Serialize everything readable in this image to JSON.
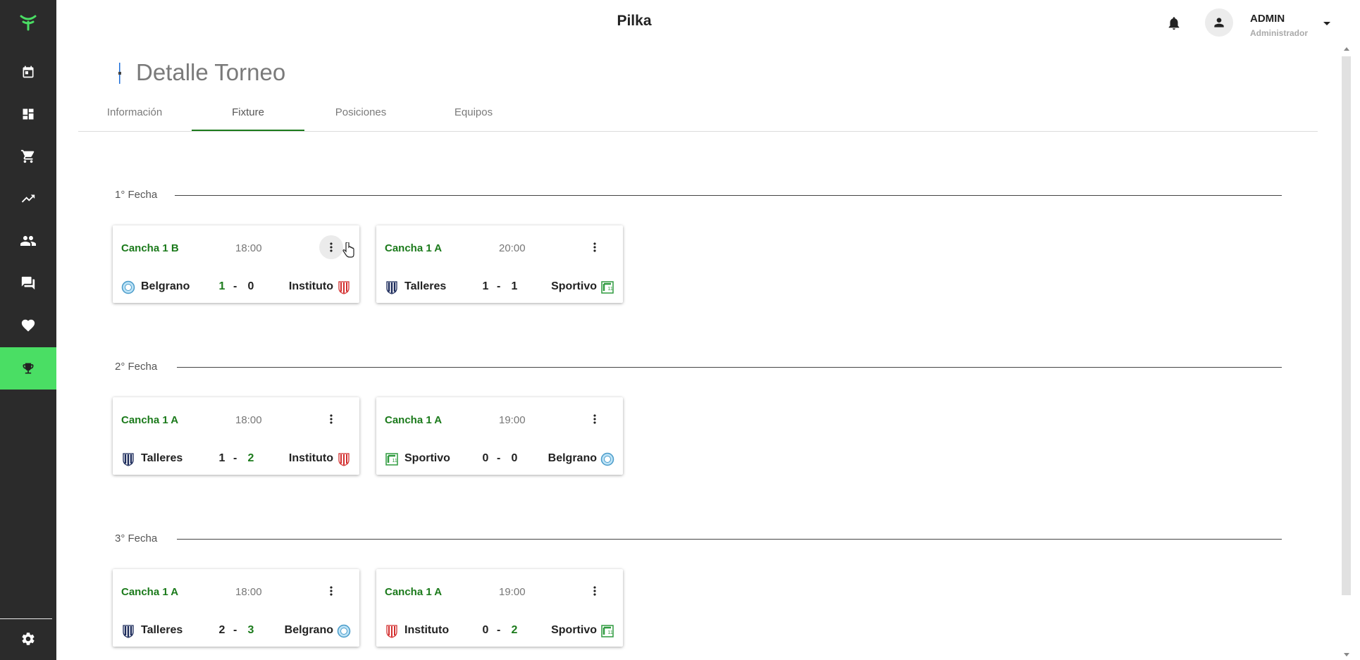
{
  "header": {
    "app_title": "Pilka"
  },
  "user": {
    "name": "ADMIN",
    "role": "Administrador"
  },
  "sidebar": {
    "items": [
      {
        "icon": "calendar-icon"
      },
      {
        "icon": "dashboard-icon"
      },
      {
        "icon": "cart-icon"
      },
      {
        "icon": "trending-up-icon"
      },
      {
        "icon": "people-icon"
      },
      {
        "icon": "chat-icon"
      },
      {
        "icon": "heart-icon"
      },
      {
        "icon": "trophy-icon",
        "active": true
      }
    ],
    "footer_icon": "gear-icon"
  },
  "page": {
    "title": "Detalle Torneo"
  },
  "tabs": [
    {
      "label": "Información"
    },
    {
      "label": "Fixture",
      "active": true
    },
    {
      "label": "Posiciones"
    },
    {
      "label": "Equipos"
    }
  ],
  "colors": {
    "accent_green": "#1b7a1b",
    "sidebar_bg": "#2b2b2b",
    "sidebar_active": "#4ade64"
  },
  "fechas": [
    {
      "label": "1° Fecha",
      "matches": [
        {
          "cancha": "Cancha 1 B",
          "time": "18:00",
          "home": "Belgrano",
          "home_score": "1",
          "away_score": "0",
          "away": "Instituto"
        },
        {
          "cancha": "Cancha 1 A",
          "time": "20:00",
          "home": "Talleres",
          "home_score": "1",
          "away_score": "1",
          "away": "Sportivo"
        }
      ]
    },
    {
      "label": "2° Fecha",
      "matches": [
        {
          "cancha": "Cancha 1 A",
          "time": "18:00",
          "home": "Talleres",
          "home_score": "1",
          "away_score": "2",
          "away": "Instituto"
        },
        {
          "cancha": "Cancha 1 A",
          "time": "19:00",
          "home": "Sportivo",
          "home_score": "0",
          "away_score": "0",
          "away": "Belgrano"
        }
      ]
    },
    {
      "label": "3° Fecha",
      "matches": [
        {
          "cancha": "Cancha 1 A",
          "time": "18:00",
          "home": "Talleres",
          "home_score": "2",
          "away_score": "3",
          "away": "Belgrano"
        },
        {
          "cancha": "Cancha 1 A",
          "time": "19:00",
          "home": "Instituto",
          "home_score": "0",
          "away_score": "2",
          "away": "Sportivo"
        }
      ]
    }
  ]
}
